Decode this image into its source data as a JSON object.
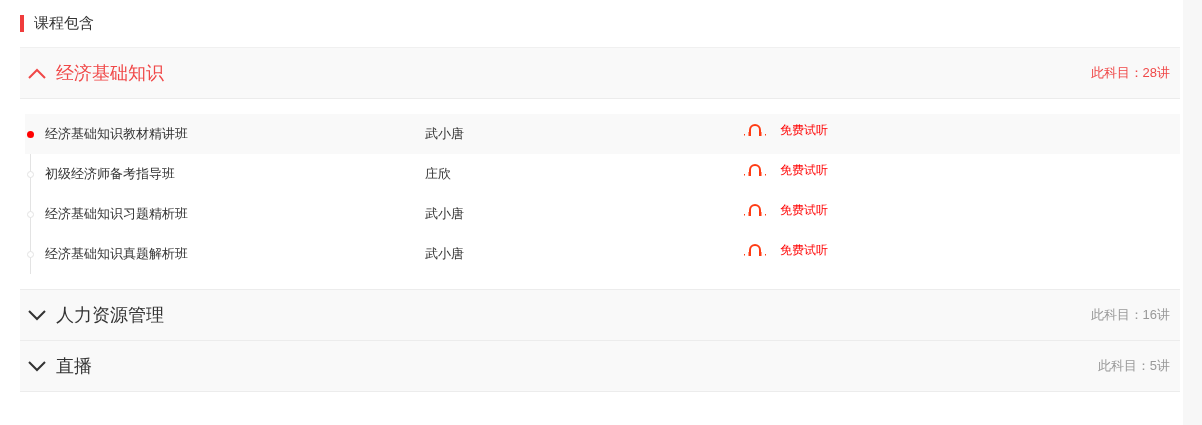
{
  "title": "课程包含",
  "subjects": [
    {
      "name": "经济基础知识",
      "count": "此科目：28讲",
      "expanded": true,
      "lessons": [
        {
          "title": "经济基础知识教材精讲班",
          "teacher": "武小唐",
          "trial": "免费试听",
          "selected": true
        },
        {
          "title": "初级经济师备考指导班",
          "teacher": "庄欣",
          "trial": "免费试听",
          "selected": false
        },
        {
          "title": "经济基础知识习题精析班",
          "teacher": "武小唐",
          "trial": "免费试听",
          "selected": false
        },
        {
          "title": "经济基础知识真题解析班",
          "teacher": "武小唐",
          "trial": "免费试听",
          "selected": false
        }
      ]
    },
    {
      "name": "人力资源管理",
      "count": "此科目：16讲",
      "expanded": false
    },
    {
      "name": "直播",
      "count": "此科目：5讲",
      "expanded": false
    }
  ]
}
